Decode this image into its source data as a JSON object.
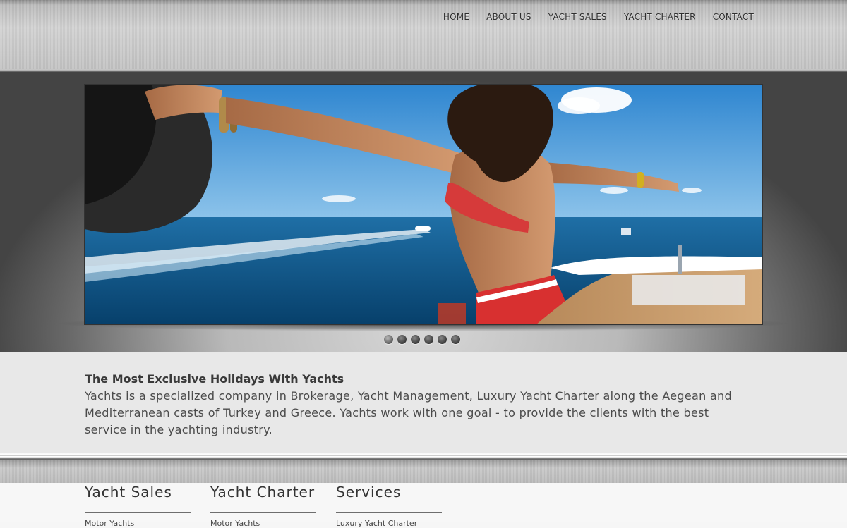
{
  "nav": {
    "items": [
      {
        "label": "HOME"
      },
      {
        "label": "ABOUT US"
      },
      {
        "label": "YACHT SALES"
      },
      {
        "label": "YACHT CHARTER"
      },
      {
        "label": "CONTACT"
      }
    ]
  },
  "slider": {
    "image_alt": "woman with outstretched arms on a yacht deck above the sea",
    "dot_count": 6,
    "active_index": 0
  },
  "intro": {
    "title": "The Most Exclusive Holidays With Yachts",
    "body": "Yachts is a specialized company in Brokerage, Yacht Management, Luxury Yacht Charter along the Aegean and Mediterranean casts of Turkey and Greece. Yachts work with one goal - to provide the clients with the best service in the yachting industry."
  },
  "footer": {
    "columns": [
      {
        "heading": "Yacht Sales",
        "first_link": "Motor Yachts"
      },
      {
        "heading": "Yacht Charter",
        "first_link": "Motor Yachts"
      },
      {
        "heading": "Services",
        "first_link": "Luxury Yacht Charter"
      }
    ]
  },
  "colors": {
    "header_silver": "#c4c4c4",
    "intro_bg": "#e8e8e8",
    "nav_text": "#2e2e2e",
    "sea": "#0d5a8e",
    "sky": "#3b97db"
  }
}
